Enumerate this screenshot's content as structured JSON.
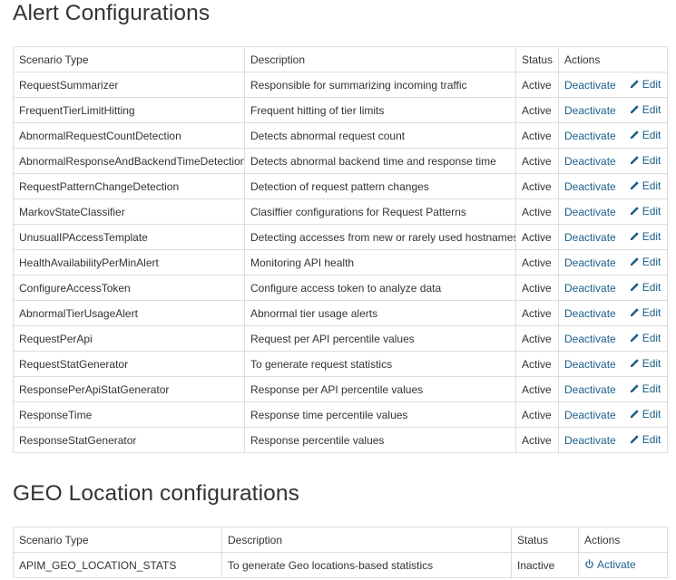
{
  "alert_section": {
    "title": "Alert Configurations",
    "headers": {
      "scenario_type": "Scenario Type",
      "description": "Description",
      "status": "Status",
      "actions": "Actions"
    },
    "rows": [
      {
        "scenario": "RequestSummarizer",
        "description": "Responsible for summarizing incoming traffic",
        "status": "Active",
        "action": "Deactivate",
        "edit": "Edit"
      },
      {
        "scenario": "FrequentTierLimitHitting",
        "description": "Frequent hitting of tier limits",
        "status": "Active",
        "action": "Deactivate",
        "edit": "Edit"
      },
      {
        "scenario": "AbnormalRequestCountDetection",
        "description": "Detects abnormal request count",
        "status": "Active",
        "action": "Deactivate",
        "edit": "Edit"
      },
      {
        "scenario": "AbnormalResponseAndBackendTimeDetection",
        "description": "Detects abnormal backend time and response time",
        "status": "Active",
        "action": "Deactivate",
        "edit": "Edit"
      },
      {
        "scenario": "RequestPatternChangeDetection",
        "description": "Detection of request pattern changes",
        "status": "Active",
        "action": "Deactivate",
        "edit": "Edit"
      },
      {
        "scenario": "MarkovStateClassifier",
        "description": "Clasiffier configurations for Request Patterns",
        "status": "Active",
        "action": "Deactivate",
        "edit": "Edit"
      },
      {
        "scenario": "UnusualIPAccessTemplate",
        "description": "Detecting accesses from new or rarely used hostnames",
        "status": "Active",
        "action": "Deactivate",
        "edit": "Edit"
      },
      {
        "scenario": "HealthAvailabilityPerMinAlert",
        "description": "Monitoring API health",
        "status": "Active",
        "action": "Deactivate",
        "edit": "Edit"
      },
      {
        "scenario": "ConfigureAccessToken",
        "description": "Configure access token to analyze data",
        "status": "Active",
        "action": "Deactivate",
        "edit": "Edit"
      },
      {
        "scenario": "AbnormalTierUsageAlert",
        "description": "Abnormal tier usage alerts",
        "status": "Active",
        "action": "Deactivate",
        "edit": "Edit"
      },
      {
        "scenario": "RequestPerApi",
        "description": "Request per API percentile values",
        "status": "Active",
        "action": "Deactivate",
        "edit": "Edit"
      },
      {
        "scenario": "RequestStatGenerator",
        "description": "To generate request statistics",
        "status": "Active",
        "action": "Deactivate",
        "edit": "Edit"
      },
      {
        "scenario": "ResponsePerApiStatGenerator",
        "description": "Response per API percentile values",
        "status": "Active",
        "action": "Deactivate",
        "edit": "Edit"
      },
      {
        "scenario": "ResponseTime",
        "description": "Response time percentile values",
        "status": "Active",
        "action": "Deactivate",
        "edit": "Edit"
      },
      {
        "scenario": "ResponseStatGenerator",
        "description": "Response percentile values",
        "status": "Active",
        "action": "Deactivate",
        "edit": "Edit"
      }
    ]
  },
  "geo_section": {
    "title": "GEO Location configurations",
    "headers": {
      "scenario_type": "Scenario Type",
      "description": "Description",
      "status": "Status",
      "actions": "Actions"
    },
    "rows": [
      {
        "scenario": "APIM_GEO_LOCATION_STATS",
        "description": "To generate Geo locations-based statistics",
        "status": "Inactive",
        "action": "Activate"
      }
    ]
  },
  "colors": {
    "link": "#1a5f8a",
    "text": "#333333",
    "border": "#dddddd"
  },
  "icons": {
    "edit": "pencil-icon",
    "activate": "power-icon"
  }
}
